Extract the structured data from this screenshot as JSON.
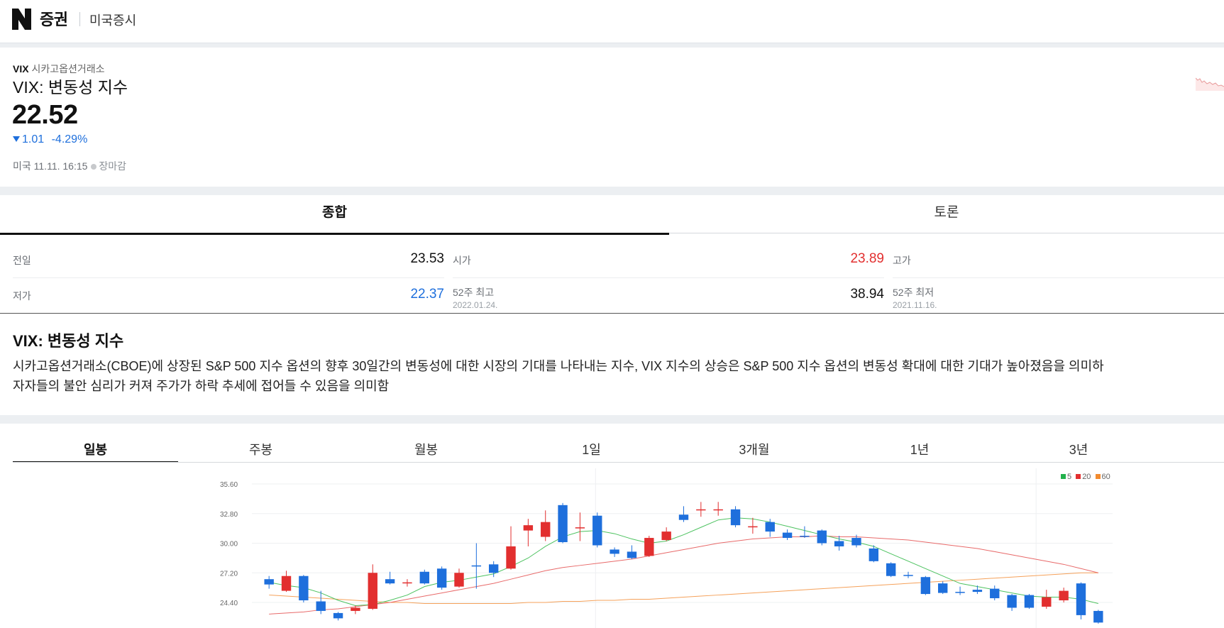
{
  "header": {
    "logo": "N",
    "brand": "증권",
    "section": "미국증시"
  },
  "quote": {
    "ticker": "VIX",
    "exchange": "시카고옵션거래소",
    "name": "VIX: 변동성 지수",
    "price": "22.52",
    "change": "1.01",
    "change_pct": "-4.29%",
    "direction": "down",
    "time": "미국 11.11. 16:15",
    "status": "장마감",
    "down_color": "#1e6fdc",
    "up_color": "#e22f2f"
  },
  "tabs": [
    {
      "label": "종합",
      "active": true
    },
    {
      "label": "토론",
      "active": false
    }
  ],
  "stats": {
    "prev_close_label": "전일",
    "prev_close": "23.53",
    "open_label": "시가",
    "open": "23.89",
    "high_label": "고가",
    "low_label": "저가",
    "low": "22.37",
    "high52_label": "52주 최고",
    "high52_date": "2022.01.24.",
    "high52": "38.94",
    "low52_label": "52주 최저",
    "low52_date": "2021.11.16."
  },
  "description": {
    "title": "VIX: 변동성 지수",
    "line1": "시카고옵션거래소(CBOE)에 상장된 S&P 500 지수 옵션의 향후 30일간의 변동성에 대한 시장의 기대를 나타내는 지수, VIX 지수의 상승은 S&P 500 지수 옵션의 변동성 확대에 대한 기대가 높아졌음을 의미하",
    "line2": "자자들의 불안 심리가 커져 주가가 하락 추세에 접어들 수 있음을 의미함"
  },
  "period_tabs": [
    {
      "label": "일봉",
      "active": true
    },
    {
      "label": "주봉",
      "active": false
    },
    {
      "label": "월봉",
      "active": false
    },
    {
      "label": "1일",
      "active": false
    },
    {
      "label": "3개월",
      "active": false
    },
    {
      "label": "1년",
      "active": false
    },
    {
      "label": "3년",
      "active": false
    }
  ],
  "chart_legend": [
    {
      "label": "5",
      "color": "#22b14c"
    },
    {
      "label": "20",
      "color": "#e22f2f"
    },
    {
      "label": "60",
      "color": "#f28b30"
    }
  ],
  "chart_data": {
    "type": "candlestick",
    "y_ticks": [
      "35.60",
      "32.80",
      "30.00",
      "27.20",
      "24.40"
    ],
    "ylim": [
      22.5,
      36.0
    ],
    "candles": [
      {
        "o": 26.1,
        "c": 26.6,
        "h": 26.9,
        "l": 25.7,
        "up": false
      },
      {
        "o": 25.5,
        "c": 26.9,
        "h": 27.4,
        "l": 25.4,
        "up": true
      },
      {
        "o": 26.9,
        "c": 24.6,
        "h": 27.0,
        "l": 24.4,
        "up": false
      },
      {
        "o": 24.5,
        "c": 23.6,
        "h": 25.5,
        "l": 23.3,
        "up": false
      },
      {
        "o": 23.4,
        "c": 22.9,
        "h": 23.5,
        "l": 22.7,
        "up": false
      },
      {
        "o": 23.6,
        "c": 23.9,
        "h": 24.1,
        "l": 23.3,
        "up": true
      },
      {
        "o": 23.8,
        "c": 27.2,
        "h": 28.0,
        "l": 23.7,
        "up": true
      },
      {
        "o": 26.6,
        "c": 26.2,
        "h": 27.3,
        "l": 26.1,
        "up": false
      },
      {
        "o": 26.2,
        "c": 26.3,
        "h": 26.6,
        "l": 25.9,
        "up": true
      },
      {
        "o": 27.3,
        "c": 26.2,
        "h": 27.5,
        "l": 26.1,
        "up": false
      },
      {
        "o": 27.6,
        "c": 25.8,
        "h": 27.8,
        "l": 25.6,
        "up": false
      },
      {
        "o": 25.9,
        "c": 27.2,
        "h": 27.6,
        "l": 25.8,
        "up": true
      },
      {
        "o": 27.9,
        "c": 27.8,
        "h": 30.0,
        "l": 25.7,
        "up": false
      },
      {
        "o": 28.0,
        "c": 27.2,
        "h": 28.3,
        "l": 26.8,
        "up": false
      },
      {
        "o": 27.6,
        "c": 29.7,
        "h": 31.6,
        "l": 27.5,
        "up": true
      },
      {
        "o": 31.2,
        "c": 31.7,
        "h": 32.3,
        "l": 29.7,
        "up": true
      },
      {
        "o": 30.6,
        "c": 32.0,
        "h": 33.1,
        "l": 30.2,
        "up": true
      },
      {
        "o": 33.6,
        "c": 30.1,
        "h": 33.8,
        "l": 30.0,
        "up": false
      },
      {
        "o": 31.4,
        "c": 31.5,
        "h": 32.9,
        "l": 30.2,
        "up": true
      },
      {
        "o": 32.6,
        "c": 29.8,
        "h": 32.9,
        "l": 29.6,
        "up": false
      },
      {
        "o": 29.4,
        "c": 29.0,
        "h": 29.6,
        "l": 28.7,
        "up": false
      },
      {
        "o": 29.2,
        "c": 28.6,
        "h": 29.8,
        "l": 28.5,
        "up": false
      },
      {
        "o": 28.8,
        "c": 30.5,
        "h": 30.7,
        "l": 28.7,
        "up": true
      },
      {
        "o": 30.3,
        "c": 31.1,
        "h": 31.5,
        "l": 30.2,
        "up": true
      },
      {
        "o": 32.7,
        "c": 32.2,
        "h": 33.5,
        "l": 32.0,
        "up": false
      },
      {
        "o": 33.1,
        "c": 33.2,
        "h": 33.9,
        "l": 32.5,
        "up": true
      },
      {
        "o": 33.1,
        "c": 33.2,
        "h": 33.9,
        "l": 32.6,
        "up": true
      },
      {
        "o": 33.2,
        "c": 31.7,
        "h": 33.5,
        "l": 31.5,
        "up": false
      },
      {
        "o": 31.5,
        "c": 31.6,
        "h": 32.4,
        "l": 30.9,
        "up": true
      },
      {
        "o": 32.0,
        "c": 31.1,
        "h": 32.3,
        "l": 30.6,
        "up": false
      },
      {
        "o": 31.0,
        "c": 30.5,
        "h": 31.3,
        "l": 30.3,
        "up": false
      },
      {
        "o": 30.7,
        "c": 30.6,
        "h": 31.6,
        "l": 30.5,
        "up": false
      },
      {
        "o": 31.2,
        "c": 30.0,
        "h": 31.3,
        "l": 29.8,
        "up": false
      },
      {
        "o": 30.2,
        "c": 29.7,
        "h": 30.7,
        "l": 29.3,
        "up": false
      },
      {
        "o": 30.5,
        "c": 29.8,
        "h": 30.8,
        "l": 29.6,
        "up": false
      },
      {
        "o": 29.5,
        "c": 28.3,
        "h": 29.8,
        "l": 28.2,
        "up": false
      },
      {
        "o": 28.1,
        "c": 26.9,
        "h": 28.2,
        "l": 26.8,
        "up": false
      },
      {
        "o": 27.0,
        "c": 26.9,
        "h": 27.3,
        "l": 26.7,
        "up": false
      },
      {
        "o": 26.8,
        "c": 25.2,
        "h": 26.9,
        "l": 25.1,
        "up": false
      },
      {
        "o": 26.2,
        "c": 25.3,
        "h": 26.4,
        "l": 25.2,
        "up": false
      },
      {
        "o": 25.4,
        "c": 25.3,
        "h": 25.9,
        "l": 25.1,
        "up": false
      },
      {
        "o": 25.6,
        "c": 25.4,
        "h": 26.0,
        "l": 25.2,
        "up": false
      },
      {
        "o": 25.7,
        "c": 24.8,
        "h": 26.0,
        "l": 24.6,
        "up": false
      },
      {
        "o": 25.1,
        "c": 23.9,
        "h": 25.2,
        "l": 23.6,
        "up": false
      },
      {
        "o": 25.1,
        "c": 23.9,
        "h": 25.2,
        "l": 23.8,
        "up": false
      },
      {
        "o": 24.0,
        "c": 24.9,
        "h": 25.6,
        "l": 23.8,
        "up": true
      },
      {
        "o": 24.6,
        "c": 25.5,
        "h": 25.8,
        "l": 24.4,
        "up": true
      },
      {
        "o": 26.2,
        "c": 23.2,
        "h": 26.3,
        "l": 22.8,
        "up": false
      },
      {
        "o": 23.6,
        "c": 22.5,
        "h": 23.7,
        "l": 22.4,
        "up": false
      }
    ],
    "ma5": [
      26.3,
      26.0,
      25.8,
      25.3,
      24.6,
      24.1,
      24.2,
      24.6,
      25.1,
      25.9,
      26.3,
      26.5,
      26.8,
      27.1,
      27.8,
      28.6,
      29.7,
      30.6,
      31.1,
      31.2,
      30.9,
      30.4,
      30.0,
      30.2,
      30.8,
      31.5,
      32.2,
      32.4,
      32.3,
      32.0,
      31.6,
      31.2,
      30.8,
      30.4,
      30.1,
      29.7,
      29.0,
      28.3,
      27.6,
      26.9,
      26.2,
      25.9,
      25.6,
      25.3,
      25.0,
      24.9,
      24.9,
      24.7,
      24.3
    ],
    "ma20": [
      23.3,
      23.4,
      23.5,
      23.7,
      23.8,
      24.0,
      24.2,
      24.4,
      24.7,
      25.0,
      25.3,
      25.6,
      25.9,
      26.2,
      26.6,
      27.0,
      27.4,
      27.7,
      27.9,
      28.1,
      28.3,
      28.5,
      28.8,
      29.1,
      29.4,
      29.7,
      30.0,
      30.2,
      30.4,
      30.5,
      30.6,
      30.6,
      30.7,
      30.6,
      30.6,
      30.5,
      30.4,
      30.3,
      30.1,
      29.9,
      29.7,
      29.5,
      29.2,
      28.9,
      28.6,
      28.3,
      28.0,
      27.6,
      27.2
    ],
    "ma60": [
      25.1,
      25.0,
      24.9,
      24.8,
      24.7,
      24.6,
      24.5,
      24.4,
      24.4,
      24.3,
      24.3,
      24.3,
      24.3,
      24.3,
      24.3,
      24.4,
      24.4,
      24.5,
      24.5,
      24.6,
      24.6,
      24.7,
      24.7,
      24.8,
      24.9,
      25.0,
      25.1,
      25.2,
      25.3,
      25.4,
      25.5,
      25.6,
      25.7,
      25.8,
      25.9,
      26.0,
      26.1,
      26.2,
      26.3,
      26.4,
      26.5,
      26.6,
      26.7,
      26.8,
      26.9,
      27.0,
      27.1,
      27.2,
      27.2
    ]
  }
}
